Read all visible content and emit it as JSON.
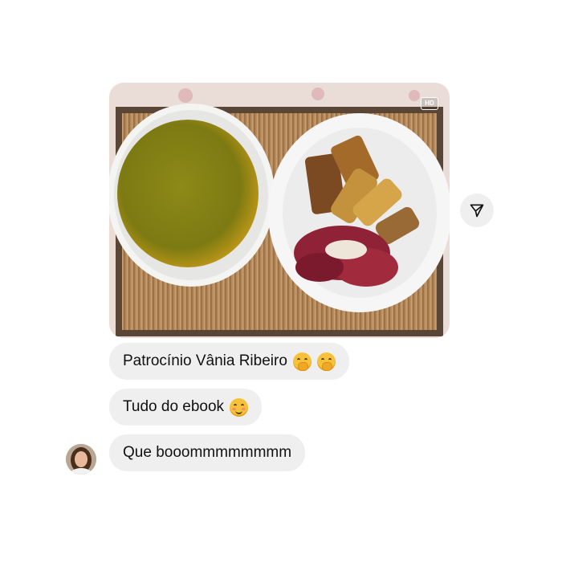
{
  "message_image": {
    "hd_label": "HD",
    "alt_subject": "soup-and-plate-photo"
  },
  "actions": {
    "share_icon": "paper-plane-icon"
  },
  "messages": [
    {
      "text": "Patrocínio Vânia Ribeiro",
      "emojis": [
        "hand-over-mouth-emoji",
        "hand-over-mouth-emoji"
      ]
    },
    {
      "text": "Tudo do ebook",
      "emojis": [
        "smiling-blush-emoji"
      ]
    },
    {
      "text": "Que booommmmmmmm",
      "emojis": []
    }
  ],
  "colors": {
    "bubble": "#efefef",
    "text": "#111111"
  }
}
